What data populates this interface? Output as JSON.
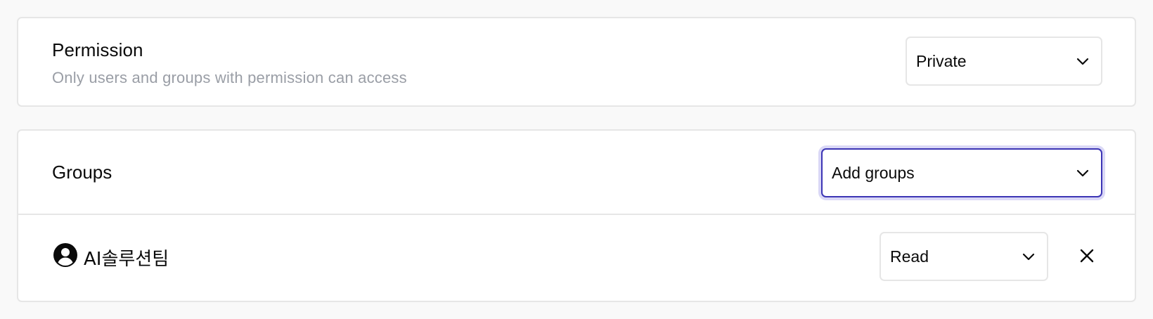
{
  "permission": {
    "title": "Permission",
    "description": "Only users and groups with permission can access",
    "selected": "Private"
  },
  "groups": {
    "title": "Groups",
    "add_placeholder": "Add groups",
    "items": [
      {
        "name": "AI솔루션팀",
        "role": "Read",
        "icon": "user-circle-icon"
      }
    ]
  },
  "icons": {
    "dropdown": "chevron-down-icon",
    "remove": "close-icon"
  },
  "colors": {
    "focus_border": "#3c35b5",
    "focus_ring": "#dad8f6",
    "muted_text": "#9a9ea6",
    "border": "#e6e6e6"
  }
}
